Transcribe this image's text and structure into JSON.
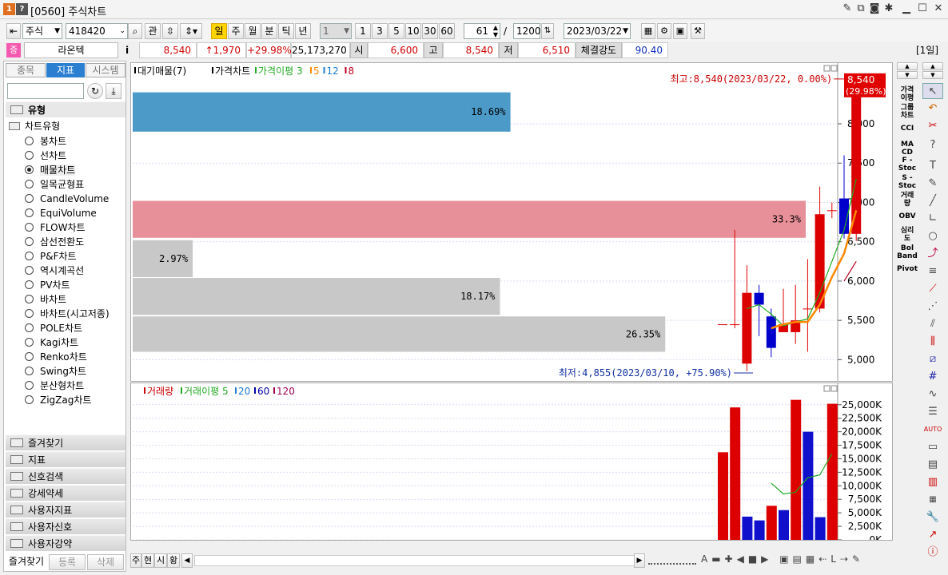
{
  "window": {
    "code_icon": "1",
    "help_icon": "?",
    "title": "[0560] 주식차트"
  },
  "toolbar": {
    "market": "주식",
    "code": "418420",
    "btn_gwan": "관",
    "periods": [
      "일",
      "주",
      "월",
      "분",
      "틱",
      "년"
    ],
    "interval": "1",
    "quick": [
      "1",
      "3",
      "5",
      "10",
      "30",
      "60"
    ],
    "count": "61",
    "slash": "/",
    "total": "1200",
    "date": "2023/03/22"
  },
  "quote": {
    "badge": "증",
    "name": "라온텍",
    "info": "i",
    "price": "8,540",
    "change": "↑1,970",
    "rate": "+29.98%",
    "volume": "25,173,270",
    "open_label": "시",
    "open": "6,600",
    "high_label": "고",
    "high": "8,540",
    "low_label": "저",
    "low": "6,510",
    "strength_label": "체결강도",
    "strength": "90.40",
    "period_badge": "[1일]"
  },
  "sidebar": {
    "tabs": [
      "종목",
      "지표",
      "시스템"
    ],
    "section": "유형",
    "group": "차트유형",
    "items": [
      "봉차트",
      "선차트",
      "매물차트",
      "일목균형표",
      "CandleVolume",
      "EquiVolume",
      "FLOW차트",
      "삼선전환도",
      "P&F차트",
      "역시계곡선",
      "PV차트",
      "바차트",
      "바차트(시고저종)",
      "POLE차트",
      "Kagi차트",
      "Renko차트",
      "Swing차트",
      "분산형차트",
      "ZigZag차트"
    ],
    "selected": 2,
    "folders": [
      "즐겨찾기",
      "지표",
      "신호검색",
      "강세약세",
      "사용자지표",
      "사용자신호",
      "사용자강약"
    ],
    "bottom_buttons": [
      "즐겨찾기",
      "등록",
      "삭제"
    ]
  },
  "legend_price": {
    "items": [
      {
        "text": "대기매물(7)",
        "color": "#000000"
      },
      {
        "text": "가격차트",
        "color": "#000000"
      },
      {
        "text": "가격이평 3",
        "color": "#22aa22"
      },
      {
        "text": "5",
        "color": "#ff8800"
      },
      {
        "text": "12",
        "color": "#1e7ad0"
      },
      {
        "text": "8",
        "color": "#c00020"
      }
    ]
  },
  "legend_vol": {
    "items": [
      {
        "text": "거래량",
        "color": "#cc0000"
      },
      {
        "text": "거래이평 5",
        "color": "#22aa22"
      },
      {
        "text": "20",
        "color": "#1e7ad0"
      },
      {
        "text": "60",
        "color": "#0000aa"
      },
      {
        "text": "120",
        "color": "#a00050"
      }
    ]
  },
  "annotations": {
    "high": "최고:8,540(2023/03/22, 0.00%)",
    "low": "최저:4,855(2023/03/10, +75.90%)",
    "last_price": "8,540",
    "last_rate": "(29.98%)"
  },
  "chart_data": [
    {
      "type": "candlestick",
      "price_ticks": [
        "8,000",
        "7,500",
        "7,000",
        "6,500",
        "6,000",
        "5,500",
        "5,000"
      ],
      "tick_values": [
        8000,
        7500,
        7000,
        6500,
        6000,
        5500,
        5000
      ],
      "ylim": [
        4750,
        8650
      ],
      "volume_profile": [
        {
          "low": 7900,
          "high": 8400,
          "pct": "18.69%",
          "color": "#4b9ac8"
        },
        {
          "low": 6550,
          "high": 7020,
          "pct": "33.3%",
          "color": "#e8909a"
        },
        {
          "low": 6050,
          "high": 6520,
          "pct": "2.97%",
          "color": "#c8c8c8"
        },
        {
          "low": 5570,
          "high": 6040,
          "pct": "18.17%",
          "color": "#c8c8c8"
        },
        {
          "low": 5100,
          "high": 5550,
          "pct": "26.35%",
          "color": "#c8c8c8"
        }
      ],
      "candles": [
        {
          "o": 5450,
          "h": 5450,
          "l": 5450,
          "c": 5450
        },
        {
          "o": 5450,
          "h": 6650,
          "l": 5400,
          "c": 5450
        },
        {
          "o": 4950,
          "h": 6200,
          "l": 4855,
          "c": 5850
        },
        {
          "o": 5850,
          "h": 5950,
          "l": 5300,
          "c": 5700
        },
        {
          "o": 5550,
          "h": 5650,
          "l": 5030,
          "c": 5150
        },
        {
          "o": 5350,
          "h": 5900,
          "l": 5350,
          "c": 5450
        },
        {
          "o": 5350,
          "h": 5950,
          "l": 5200,
          "c": 5500
        },
        {
          "o": 5650,
          "h": 6280,
          "l": 5100,
          "c": 5650
        },
        {
          "o": 5650,
          "h": 7200,
          "l": 5600,
          "c": 6850
        },
        {
          "o": 6900,
          "h": 7000,
          "l": 6800,
          "c": 6900
        },
        {
          "o": 7050,
          "h": 7600,
          "l": 6540,
          "c": 6600
        },
        {
          "o": 6600,
          "h": 8540,
          "l": 6510,
          "c": 8540
        }
      ],
      "ma3": [
        null,
        null,
        5650,
        5700,
        5580,
        5430,
        5480,
        5520,
        5850,
        6250,
        6650,
        7300
      ],
      "ma5": [
        null,
        null,
        null,
        null,
        5400,
        5450,
        5480,
        5480,
        5700,
        6050,
        6350,
        6900
      ],
      "ma8": [
        null,
        null,
        null,
        null,
        null,
        null,
        null,
        null,
        null,
        null,
        6000,
        6250
      ]
    },
    {
      "type": "bar",
      "title": "거래량",
      "vol_ticks": [
        "25,000K",
        "22,500K",
        "20,000K",
        "17,500K",
        "15,000K",
        "12,500K",
        "10,000K",
        "7,500K",
        "5,000K",
        "2,500K",
        "0K"
      ],
      "ylim": [
        0,
        26000
      ],
      "volumes": [
        {
          "v": 16200,
          "up": true
        },
        {
          "v": 24500,
          "up": true
        },
        {
          "v": 4300,
          "up": false
        },
        {
          "v": 3600,
          "up": false
        },
        {
          "v": 6300,
          "up": true
        },
        {
          "v": 5500,
          "up": false
        },
        {
          "v": 25900,
          "up": true
        },
        {
          "v": 20000,
          "up": false
        },
        {
          "v": 4200,
          "up": false
        },
        {
          "v": 25173,
          "up": true
        }
      ],
      "vma5": [
        null,
        null,
        null,
        null,
        10500,
        8500,
        8800,
        11500,
        12000,
        15900
      ]
    }
  ]
}
